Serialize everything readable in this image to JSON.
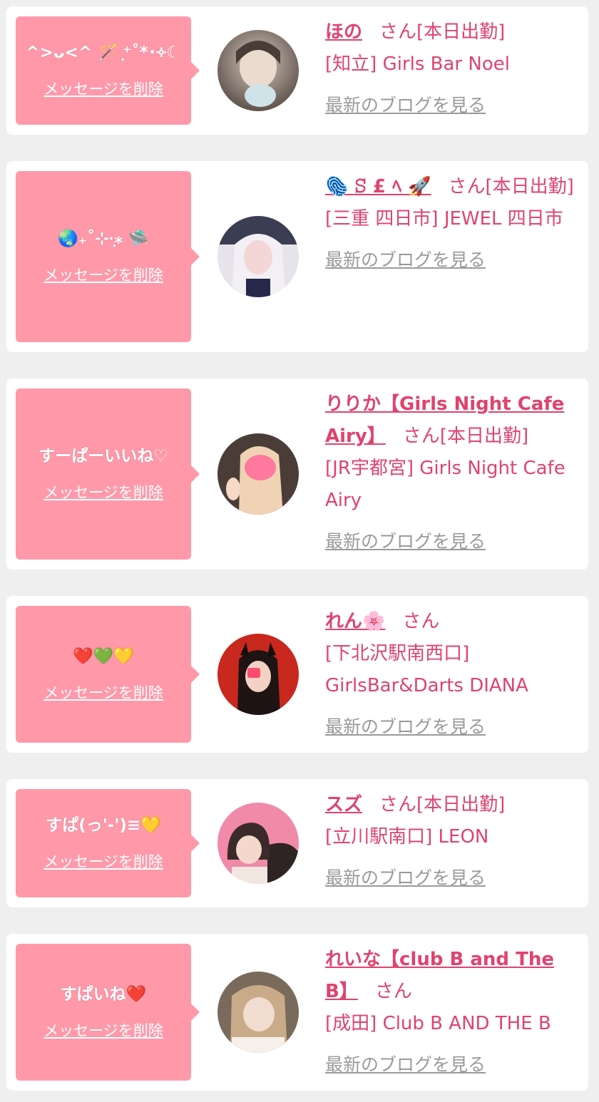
{
  "delete_label": "メッセージを削除",
  "san": "さん",
  "blog_label": "最新のブログを見る",
  "colors": {
    "accent": "#e0436e",
    "bubble": "#ff99aa",
    "link_gray": "#9a9a9a",
    "background": "#efefef"
  },
  "items": [
    {
      "message": "^>ᴗ<^ 🪄 ͙⁺˚*･༓☾",
      "name": "ほの",
      "status": "[本日出勤]",
      "shop": "[知立] Girls Bar Noel",
      "avatar_colors": [
        "#6a5c55",
        "#c9bdb2"
      ]
    },
    {
      "message": "🌏₊˚⊹·͙⁎ 🛸",
      "name": "🫆 ꕶ £ ﾍ 🚀",
      "status": "[本日出勤]",
      "shop": "[三重 四日市] JEWEL 四日市",
      "avatar_colors": [
        "#3b3d52",
        "#e8e4ee"
      ]
    },
    {
      "message": "すーぱーいいね♡",
      "name": "りりか【Girls Night Cafe Airy】",
      "status": "[本日出勤]",
      "shop": "[JR宇都宮] Girls Night Cafe Airy",
      "avatar_colors": [
        "#5a4a42",
        "#f1d7b8"
      ]
    },
    {
      "message": "❤️💚💛",
      "name": "れん🌸",
      "status": "",
      "shop": "[下北沢駅南西口] GirlsBar&Darts DIANA",
      "avatar_colors": [
        "#c8281e",
        "#2a1a1a"
      ]
    },
    {
      "message": "すぱ(っ'-')≡💛",
      "name": "スズ",
      "status": "[本日出勤]",
      "shop": "[立川駅南口] LEON",
      "avatar_colors": [
        "#f08aa8",
        "#3a2a2a"
      ]
    },
    {
      "message": "すぱいね❤️",
      "name": "れいな【club B and The B】",
      "status": "",
      "shop": "[成田] Club B AND THE B",
      "avatar_colors": [
        "#b89a7c",
        "#f3ece6"
      ]
    }
  ]
}
